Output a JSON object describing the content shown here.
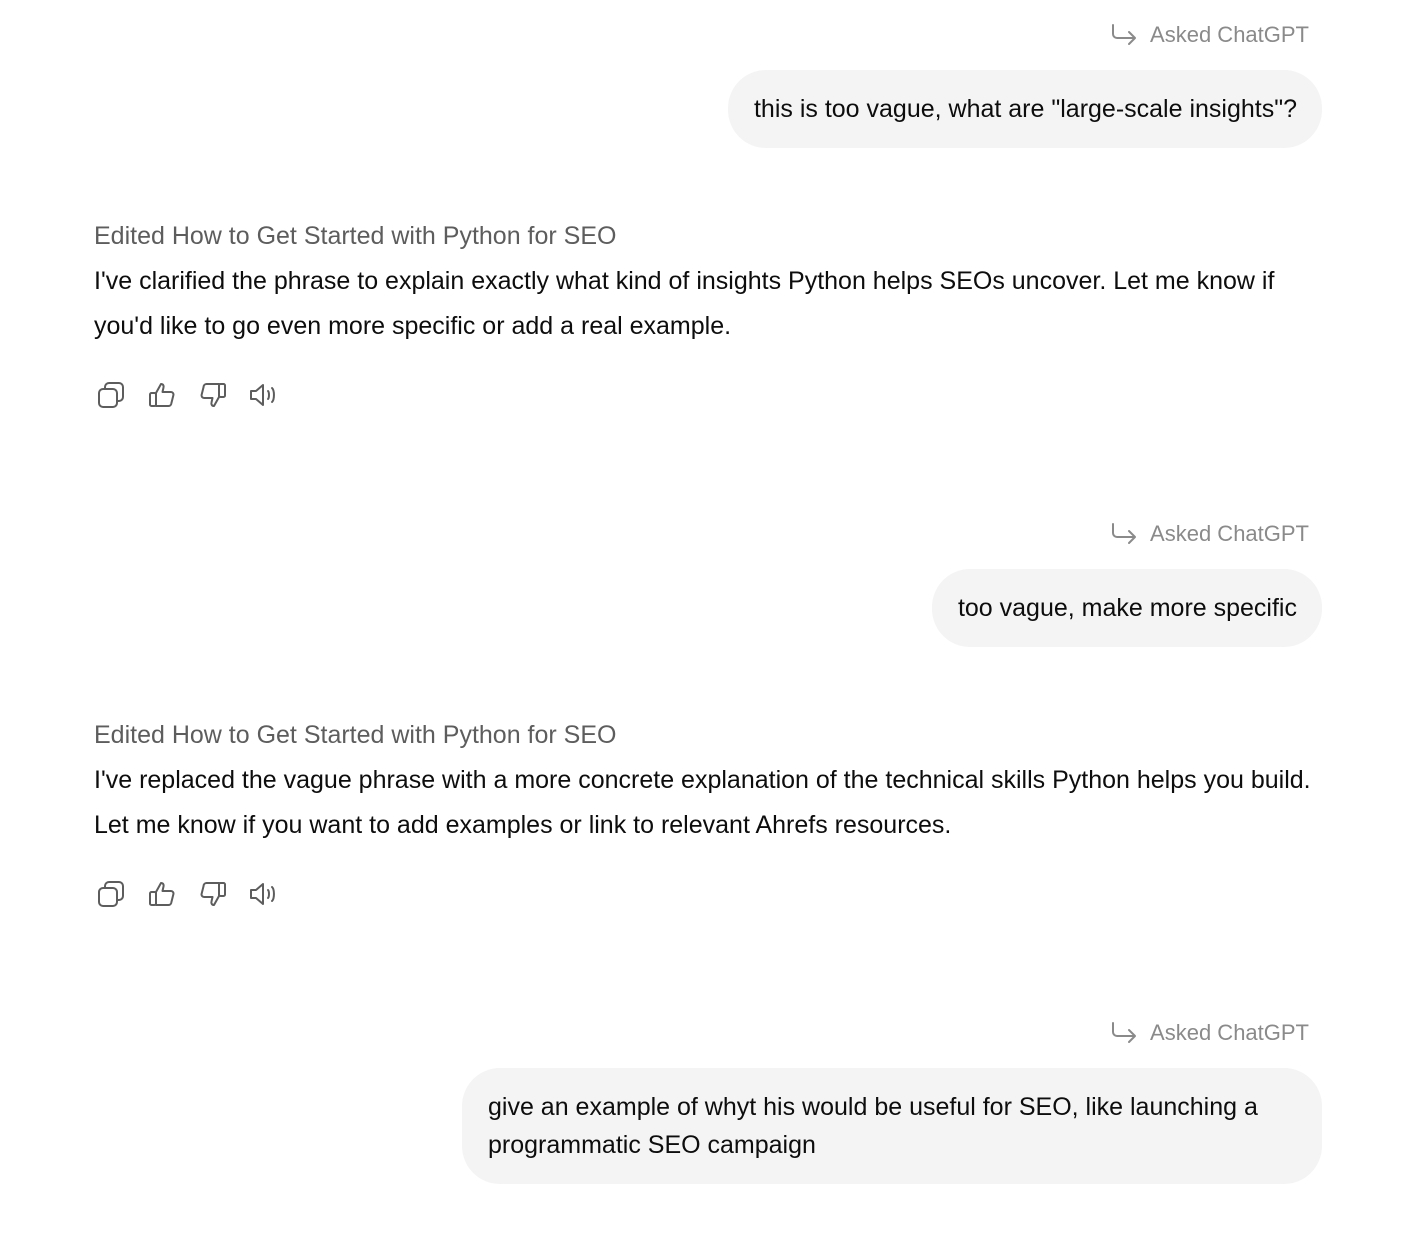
{
  "turns": [
    {
      "asked_label": "Asked ChatGPT",
      "user_message": "this is too vague, what are \"large-scale insights\"?",
      "edited_label": "Edited How to Get Started with Python for SEO",
      "assistant_message": "I've clarified the phrase to explain exactly what kind of insights Python helps SEOs uncover. Let me know if you'd like to go even more specific or add a real example."
    },
    {
      "asked_label": "Asked ChatGPT",
      "user_message": "too vague, make more specific",
      "edited_label": "Edited How to Get Started with Python for SEO",
      "assistant_message": "I've replaced the vague phrase with a more concrete explanation of the technical skills Python helps you build. Let me know if you want to add examples or link to relevant Ahrefs resources."
    },
    {
      "asked_label": "Asked ChatGPT",
      "user_message": "give an example of whyt his would be useful for SEO, like launching a programmatic SEO campaign"
    }
  ],
  "action_icons": [
    "copy-icon",
    "thumbs-up-icon",
    "thumbs-down-icon",
    "read-aloud-icon"
  ],
  "colors": {
    "bubble_bg": "#f4f4f4",
    "muted_text": "#8a8a8a",
    "edited_text": "#5d5d5d",
    "text": "#0d0d0d"
  }
}
